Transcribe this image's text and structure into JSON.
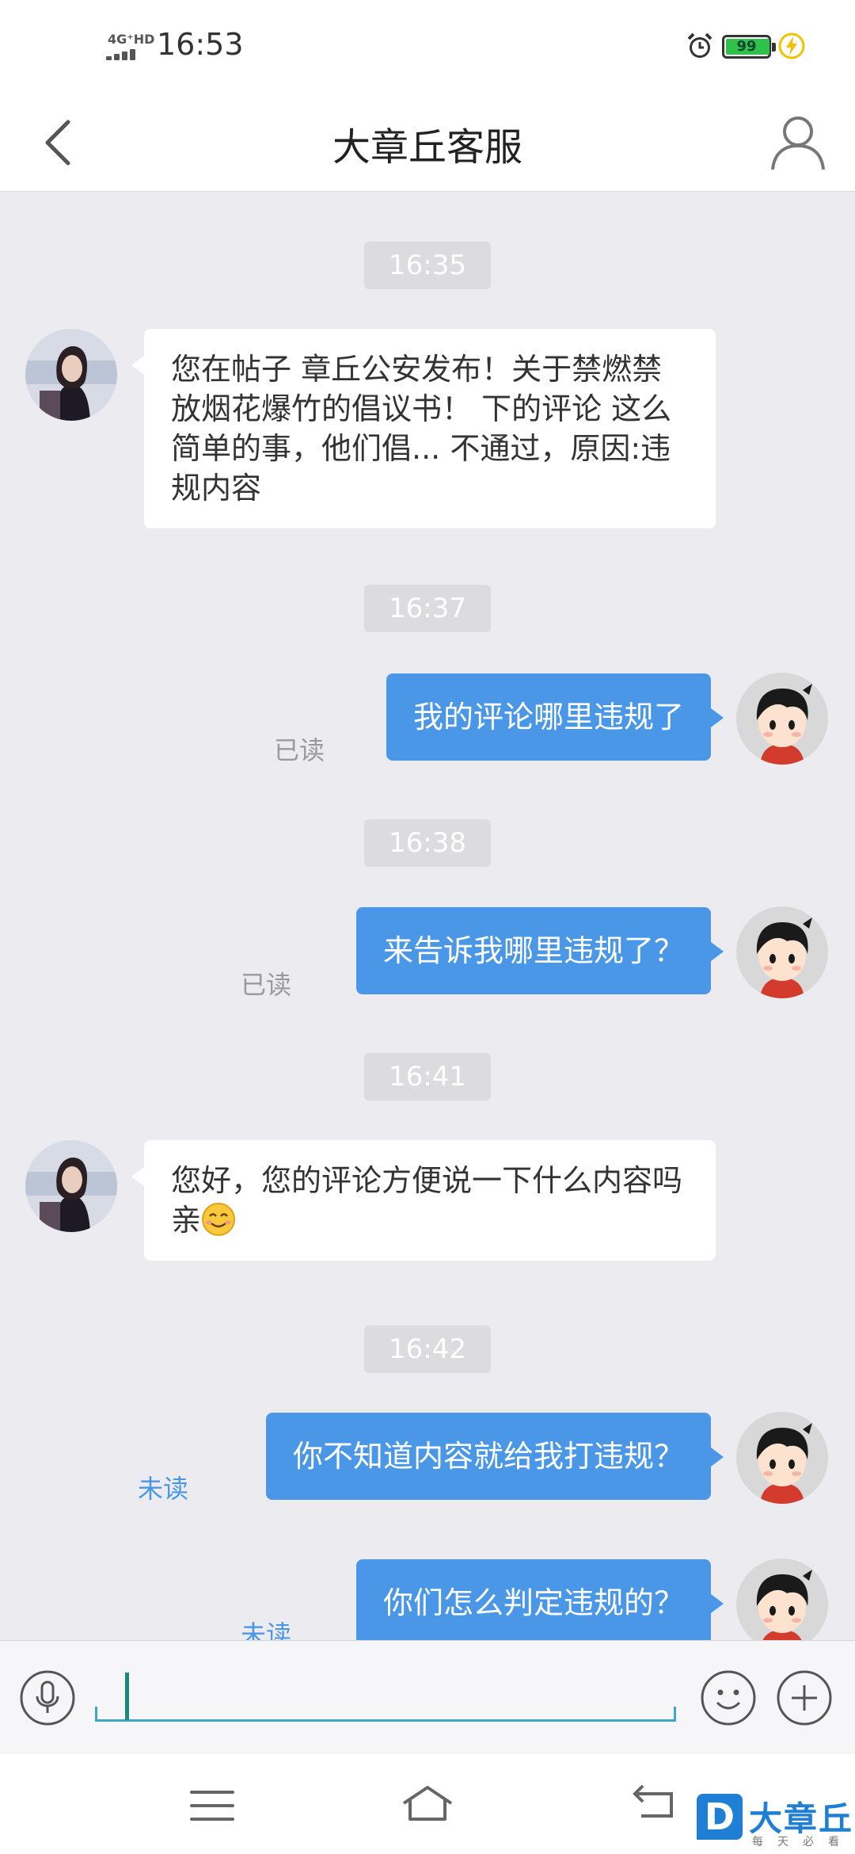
{
  "status_bar": {
    "network": "4G⁺HD",
    "time": "16:53",
    "battery": "99",
    "battery_level": 0.99,
    "icons": [
      "alarm-icon",
      "battery-icon",
      "charging-icon"
    ]
  },
  "header": {
    "title": "大章丘客服",
    "icons": [
      "back-icon",
      "profile-icon"
    ]
  },
  "messages": [
    {
      "type": "timestamp",
      "text": "16:35"
    },
    {
      "type": "incoming",
      "text": "您在帖子 章丘公安发布！关于禁燃禁放烟花爆竹的倡议书！ 下的评论 这么简单的事，他们倡... 不通过，原因:违规内容"
    },
    {
      "type": "timestamp",
      "text": "16:37"
    },
    {
      "type": "outgoing",
      "text": "我的评论哪里违规了",
      "receipt": "已读"
    },
    {
      "type": "timestamp",
      "text": "16:38"
    },
    {
      "type": "outgoing",
      "text": "来告诉我哪里违规了？",
      "receipt": "已读"
    },
    {
      "type": "timestamp",
      "text": "16:41"
    },
    {
      "type": "incoming",
      "text": "您好，您的评论方便说一下什么内容吗亲",
      "emoji": "smiling-face-emoji"
    },
    {
      "type": "timestamp",
      "text": "16:42"
    },
    {
      "type": "outgoing",
      "text": "你不知道内容就给我打违规？",
      "receipt": "未读"
    },
    {
      "type": "outgoing",
      "text": "你们怎么判定违规的？",
      "receipt": "未读"
    }
  ],
  "input_bar": {
    "value": "",
    "icons": [
      "microphone-icon",
      "emoji-icon",
      "plus-icon"
    ]
  },
  "nav_bar": {
    "icons": [
      "menu-icon",
      "home-icon",
      "back-arrow-icon"
    ]
  },
  "watermark": {
    "logo_letter": "D",
    "title": "大章丘",
    "subtitle": "每天必看"
  },
  "colors": {
    "outgoing_bubble": "#4a97e8",
    "chat_background": "#ececf0",
    "unread_receipt": "#4a97e8",
    "read_receipt": "#9a9a9a",
    "battery_fill": "#2fc14a",
    "watermark_brand": "#1e7fd4"
  }
}
